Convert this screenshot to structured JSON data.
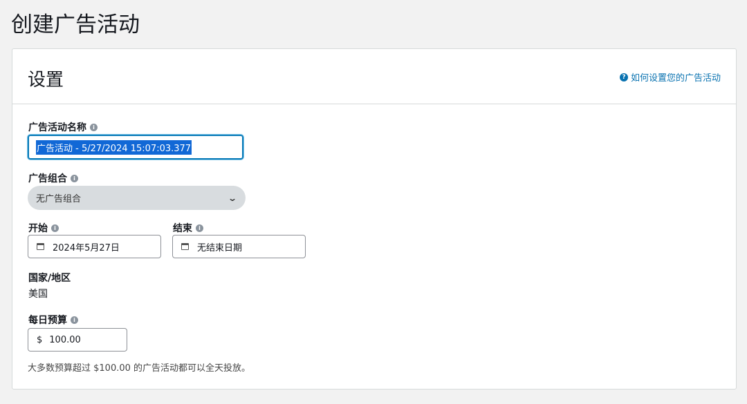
{
  "page_title": "创建广告活动",
  "settings": {
    "title": "设置",
    "help_link": "如何设置您的广告活动",
    "campaign_name": {
      "label": "广告活动名称",
      "value": "广告活动 - 5/27/2024 15:07:03.377"
    },
    "ad_group": {
      "label": "广告组合",
      "value": "无广告组合"
    },
    "start": {
      "label": "开始",
      "value": "2024年5月27日"
    },
    "end": {
      "label": "结束",
      "value": "无结束日期"
    },
    "country": {
      "label": "国家/地区",
      "value": "美国"
    },
    "daily_budget": {
      "label": "每日预算",
      "currency": "$",
      "value": "100.00"
    },
    "budget_note": "大多数预算超过 $100.00 的广告活动都可以全天投放。"
  }
}
